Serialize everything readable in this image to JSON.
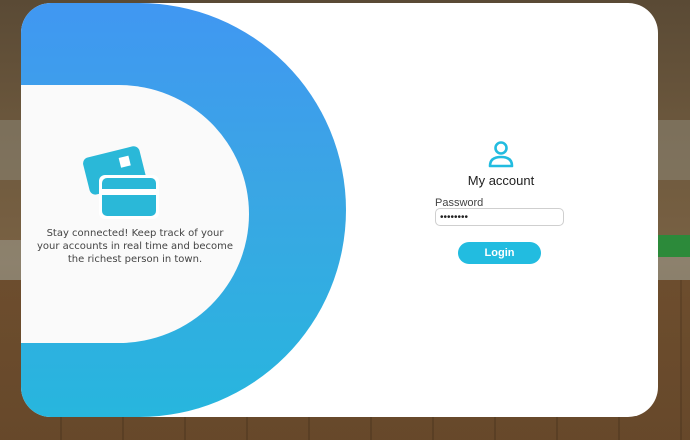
{
  "background": {
    "accent_blue": "#4097f2",
    "accent_cyan": "#22bce0"
  },
  "promo": {
    "icon": "credit-cards-icon",
    "text": "Stay connected! Keep track of your your accounts in real time and become the richest person in town."
  },
  "login": {
    "icon": "user-icon",
    "title": "My account",
    "password_label": "Password",
    "password_value": "••••••••",
    "button_label": "Login"
  }
}
